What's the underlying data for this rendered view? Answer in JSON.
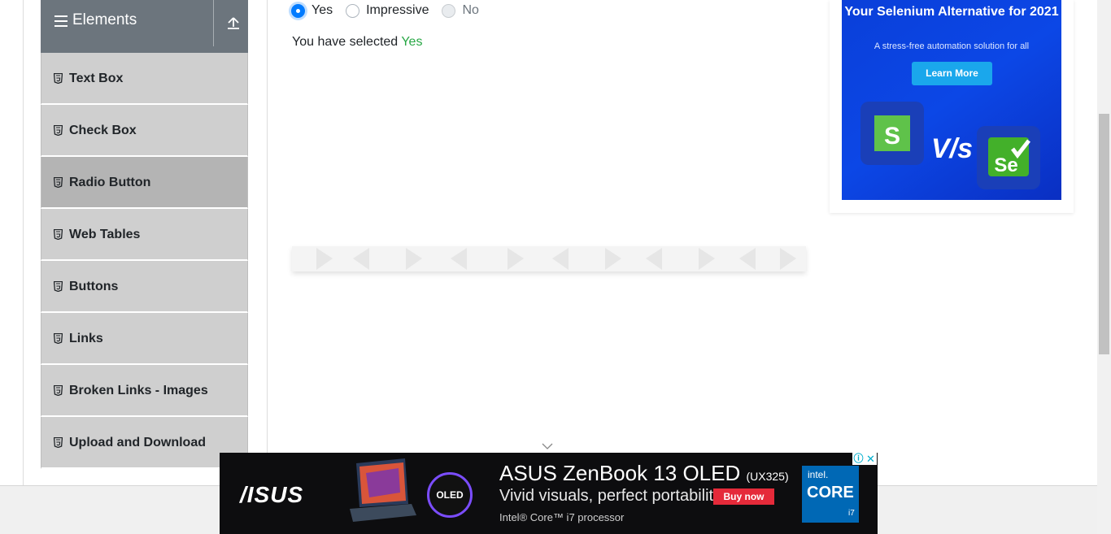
{
  "sidebar": {
    "group_title": "Elements",
    "items": [
      {
        "label": "Text Box",
        "active": false
      },
      {
        "label": "Check Box",
        "active": false
      },
      {
        "label": "Radio Button",
        "active": true
      },
      {
        "label": "Web Tables",
        "active": false
      },
      {
        "label": "Buttons",
        "active": false
      },
      {
        "label": "Links",
        "active": false
      },
      {
        "label": "Broken Links - Images",
        "active": false
      },
      {
        "label": "Upload and Download",
        "active": false
      }
    ]
  },
  "radio_group": {
    "options": [
      {
        "label": "Yes",
        "state": "checked"
      },
      {
        "label": "Impressive",
        "state": "unchecked"
      },
      {
        "label": "No",
        "state": "disabled"
      }
    ]
  },
  "result": {
    "prefix": "You have selected ",
    "value": "Yes"
  },
  "side_ad": {
    "title": "Your Selenium Alternative for 2021",
    "subtitle": "A stress-free automation solution for all",
    "button": "Learn More",
    "vs_text": "V/s"
  },
  "bottom_ad": {
    "brand": "/ISUS",
    "oled": "OLED",
    "headline": "ASUS ZenBook 13 OLED",
    "model": "(UX325)",
    "tagline": "Vivid visuals, perfect portability",
    "cta": "Buy now",
    "fine_print": "Intel® Core™ i7 processor",
    "intel_brand": "intel.",
    "intel_core": "CORE",
    "intel_tier": "i7"
  },
  "colors": {
    "accent": "#007bff",
    "success": "#28a745",
    "header_bg": "#6c757d",
    "menu_bg": "#cfcfcf",
    "menu_active_bg": "#b4b4b4"
  }
}
